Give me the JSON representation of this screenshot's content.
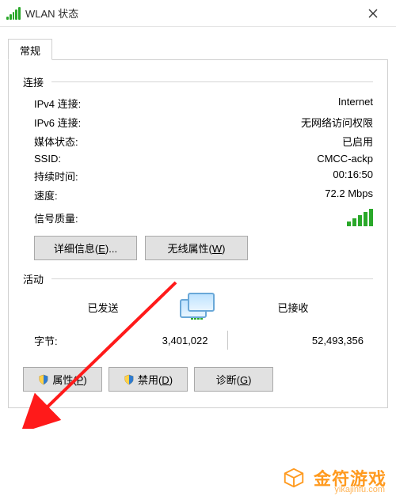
{
  "window": {
    "title": "WLAN 状态"
  },
  "tabs": {
    "general": "常规"
  },
  "connection": {
    "section": "连接",
    "ipv4_label": "IPv4 连接:",
    "ipv4_value": "Internet",
    "ipv6_label": "IPv6 连接:",
    "ipv6_value": "无网络访问权限",
    "media_label": "媒体状态:",
    "media_value": "已启用",
    "ssid_label": "SSID:",
    "ssid_value": "CMCC-ackp",
    "duration_label": "持续时间:",
    "duration_value": "00:16:50",
    "speed_label": "速度:",
    "speed_value": "72.2 Mbps",
    "signal_label": "信号质量:"
  },
  "buttons": {
    "details_pre": "详细信息(",
    "details_hot": "E",
    "details_post": ")...",
    "wireless_pre": "无线属性(",
    "wireless_hot": "W",
    "wireless_post": ")",
    "properties_pre": "属性(",
    "properties_hot": "P",
    "properties_post": ")",
    "disable_pre": "禁用(",
    "disable_hot": "D",
    "disable_post": ")",
    "diagnose_pre": "诊断(",
    "diagnose_hot": "G",
    "diagnose_post": ")"
  },
  "activity": {
    "section": "活动",
    "sent": "已发送",
    "received": "已接收",
    "bytes_label": "字节:",
    "bytes_sent": "3,401,022",
    "bytes_received": "52,493,356"
  },
  "watermark": {
    "brand": "金符游戏",
    "url": "yikajinfu.com"
  }
}
